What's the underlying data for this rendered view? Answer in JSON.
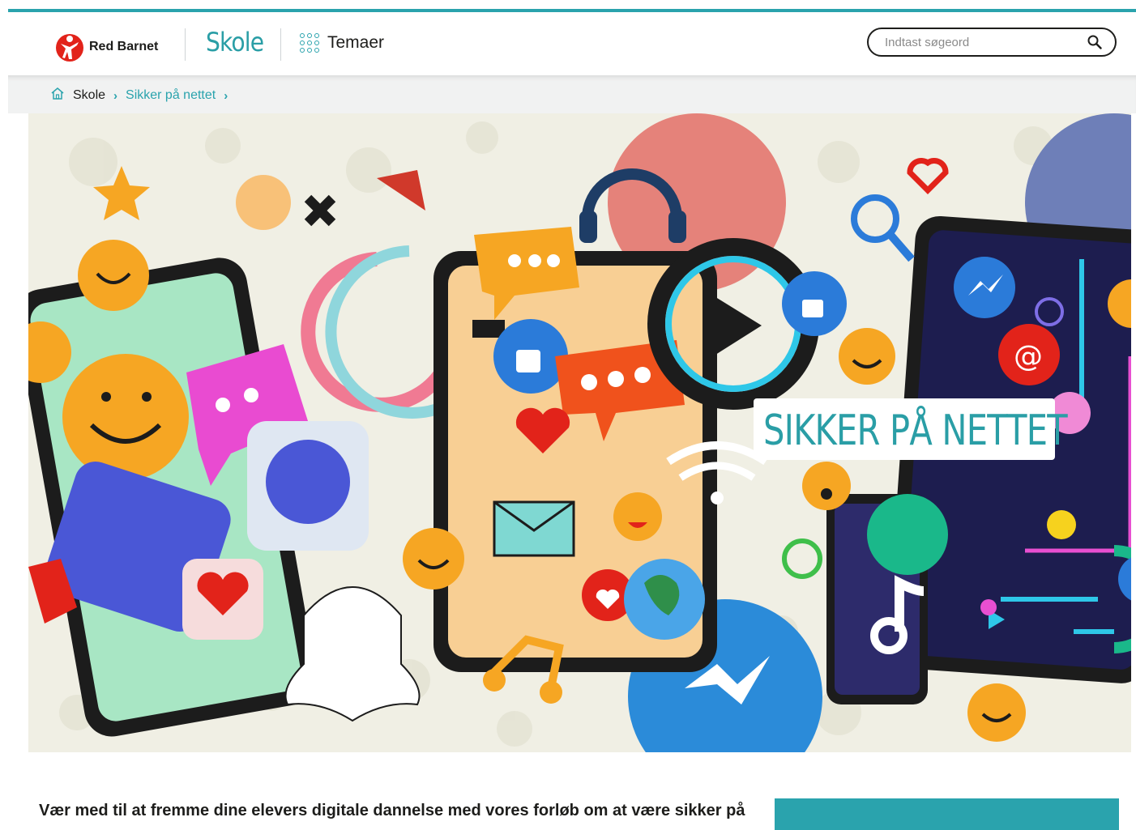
{
  "header": {
    "logo_text": "Red Barnet",
    "section_title": "Skole",
    "themes_label": "Temaer",
    "search_placeholder": "Indtast søgeord"
  },
  "breadcrumb": {
    "items": [
      "Skole",
      "Sikker på nettet"
    ]
  },
  "hero": {
    "title": "SIKKER PÅ NETTET"
  },
  "main": {
    "intro_text": "Vær med til at fremme dine elevers digitale dannelse med vores forløb om at være sikker på"
  },
  "colors": {
    "accent": "#2aa3ad",
    "brand_red": "#e2231a",
    "text": "#1d1d1b",
    "breadcrumb_bg": "#f1f2f2"
  }
}
